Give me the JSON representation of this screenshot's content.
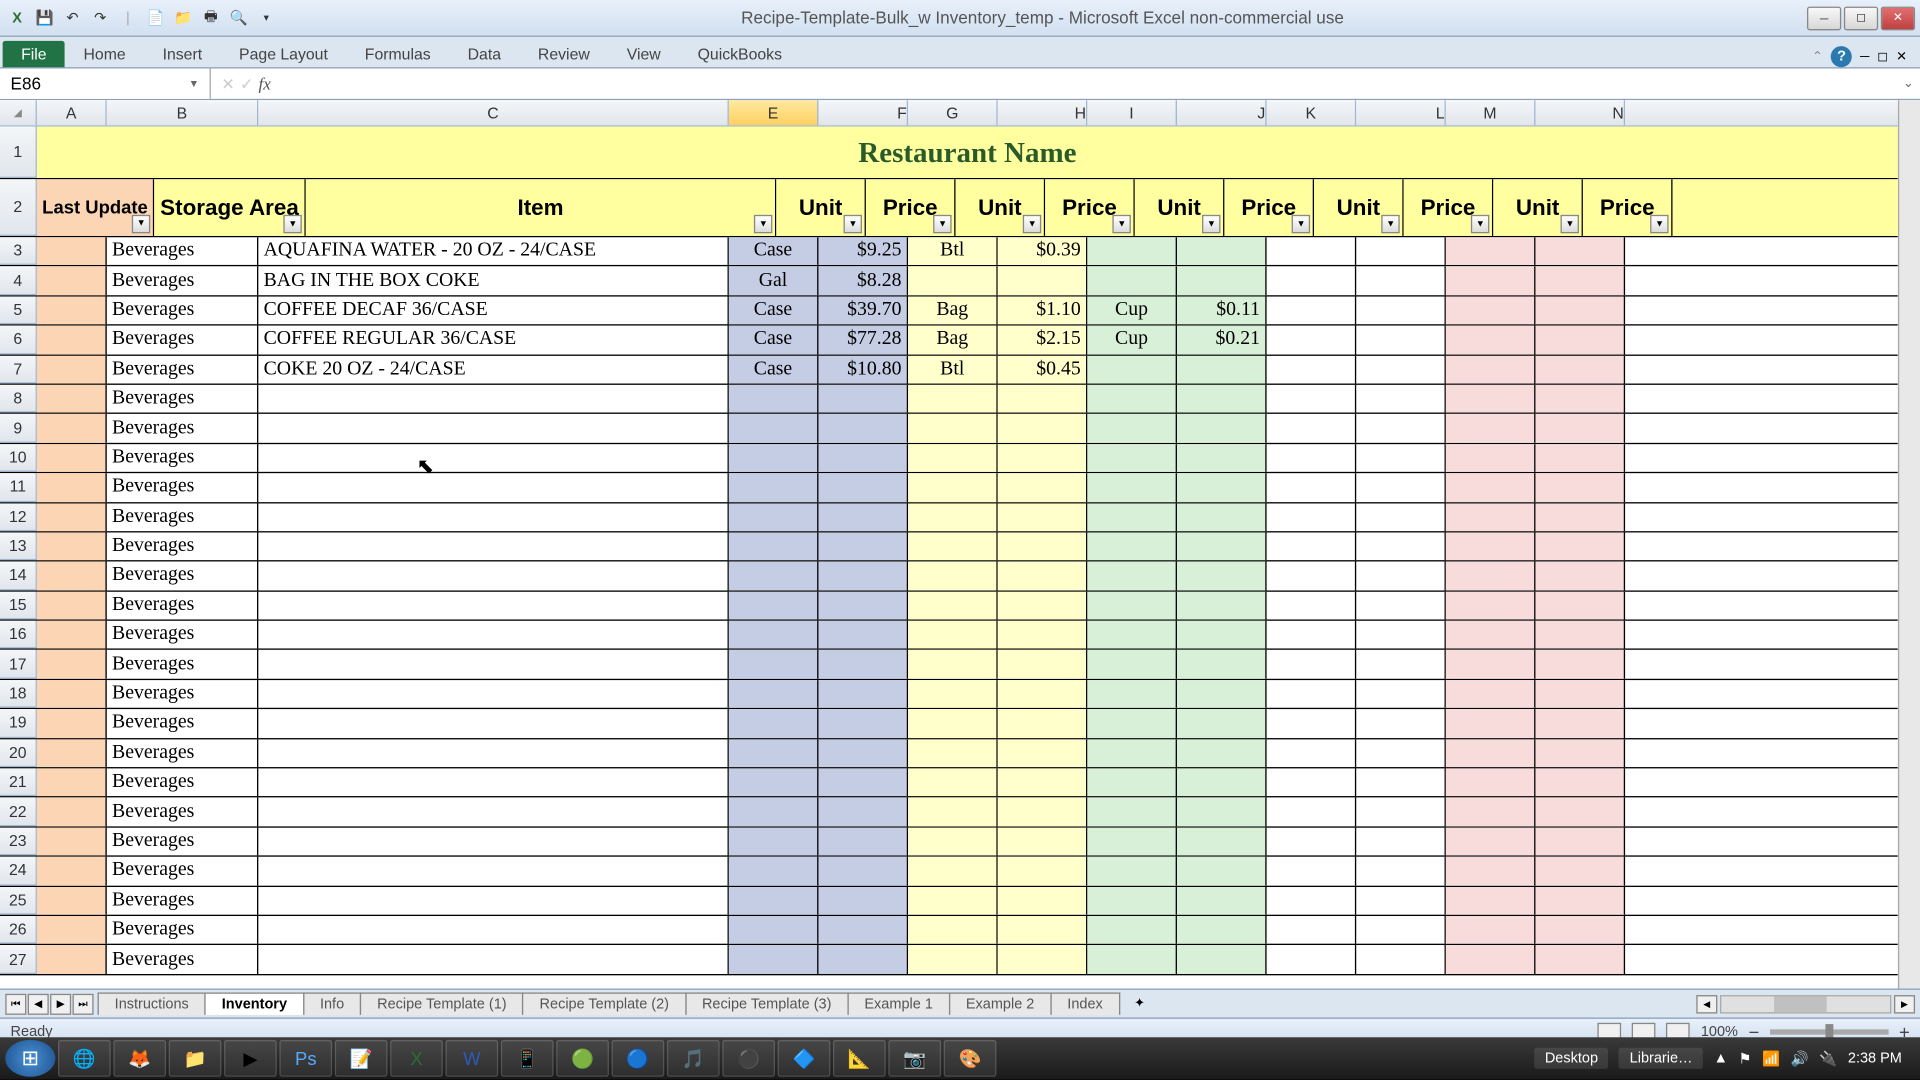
{
  "window": {
    "title": "Recipe-Template-Bulk_w Inventory_temp  -  Microsoft Excel non-commercial use"
  },
  "ribbon": {
    "file": "File",
    "tabs": [
      "Home",
      "Insert",
      "Page Layout",
      "Formulas",
      "Data",
      "Review",
      "View",
      "QuickBooks"
    ]
  },
  "formula_bar": {
    "name_box": "E86",
    "fx": "fx",
    "formula": ""
  },
  "columns": [
    "A",
    "B",
    "C",
    "E",
    "F",
    "G",
    "H",
    "I",
    "J",
    "K",
    "L",
    "M",
    "N"
  ],
  "selected_col": "E",
  "sheet": {
    "title": "Restaurant Name",
    "headers": {
      "a": "Last Update",
      "b": "Storage Area",
      "c": "Item",
      "unit": "Unit",
      "price": "Price"
    },
    "rows": [
      {
        "n": 3,
        "area": "Beverages",
        "item": "AQUAFINA WATER - 20 OZ - 24/CASE",
        "u1": "Case",
        "p1": "$9.25",
        "u2": "Btl",
        "p2": "$0.39",
        "u3": "",
        "p3": ""
      },
      {
        "n": 4,
        "area": "Beverages",
        "item": "BAG IN THE BOX COKE",
        "u1": "Gal",
        "p1": "$8.28",
        "u2": "",
        "p2": "",
        "u3": "",
        "p3": ""
      },
      {
        "n": 5,
        "area": "Beverages",
        "item": "COFFEE DECAF 36/CASE",
        "u1": "Case",
        "p1": "$39.70",
        "u2": "Bag",
        "p2": "$1.10",
        "u3": "Cup",
        "p3": "$0.11"
      },
      {
        "n": 6,
        "area": "Beverages",
        "item": "COFFEE REGULAR 36/CASE",
        "u1": "Case",
        "p1": "$77.28",
        "u2": "Bag",
        "p2": "$2.15",
        "u3": "Cup",
        "p3": "$0.21"
      },
      {
        "n": 7,
        "area": "Beverages",
        "item": "COKE 20 OZ - 24/CASE",
        "u1": "Case",
        "p1": "$10.80",
        "u2": "Btl",
        "p2": "$0.45",
        "u3": "",
        "p3": ""
      },
      {
        "n": 8,
        "area": "Beverages",
        "item": "",
        "u1": "",
        "p1": "",
        "u2": "",
        "p2": "",
        "u3": "",
        "p3": ""
      },
      {
        "n": 9,
        "area": "Beverages",
        "item": "",
        "u1": "",
        "p1": "",
        "u2": "",
        "p2": "",
        "u3": "",
        "p3": ""
      },
      {
        "n": 10,
        "area": "Beverages",
        "item": "",
        "u1": "",
        "p1": "",
        "u2": "",
        "p2": "",
        "u3": "",
        "p3": ""
      },
      {
        "n": 11,
        "area": "Beverages",
        "item": "",
        "u1": "",
        "p1": "",
        "u2": "",
        "p2": "",
        "u3": "",
        "p3": ""
      },
      {
        "n": 12,
        "area": "Beverages",
        "item": "",
        "u1": "",
        "p1": "",
        "u2": "",
        "p2": "",
        "u3": "",
        "p3": ""
      },
      {
        "n": 13,
        "area": "Beverages",
        "item": "",
        "u1": "",
        "p1": "",
        "u2": "",
        "p2": "",
        "u3": "",
        "p3": ""
      },
      {
        "n": 14,
        "area": "Beverages",
        "item": "",
        "u1": "",
        "p1": "",
        "u2": "",
        "p2": "",
        "u3": "",
        "p3": ""
      },
      {
        "n": 15,
        "area": "Beverages",
        "item": "",
        "u1": "",
        "p1": "",
        "u2": "",
        "p2": "",
        "u3": "",
        "p3": ""
      },
      {
        "n": 16,
        "area": "Beverages",
        "item": "",
        "u1": "",
        "p1": "",
        "u2": "",
        "p2": "",
        "u3": "",
        "p3": ""
      },
      {
        "n": 17,
        "area": "Beverages",
        "item": "",
        "u1": "",
        "p1": "",
        "u2": "",
        "p2": "",
        "u3": "",
        "p3": ""
      },
      {
        "n": 18,
        "area": "Beverages",
        "item": "",
        "u1": "",
        "p1": "",
        "u2": "",
        "p2": "",
        "u3": "",
        "p3": ""
      },
      {
        "n": 19,
        "area": "Beverages",
        "item": "",
        "u1": "",
        "p1": "",
        "u2": "",
        "p2": "",
        "u3": "",
        "p3": ""
      },
      {
        "n": 20,
        "area": "Beverages",
        "item": "",
        "u1": "",
        "p1": "",
        "u2": "",
        "p2": "",
        "u3": "",
        "p3": ""
      },
      {
        "n": 21,
        "area": "Beverages",
        "item": "",
        "u1": "",
        "p1": "",
        "u2": "",
        "p2": "",
        "u3": "",
        "p3": ""
      },
      {
        "n": 22,
        "area": "Beverages",
        "item": "",
        "u1": "",
        "p1": "",
        "u2": "",
        "p2": "",
        "u3": "",
        "p3": ""
      },
      {
        "n": 23,
        "area": "Beverages",
        "item": "",
        "u1": "",
        "p1": "",
        "u2": "",
        "p2": "",
        "u3": "",
        "p3": ""
      },
      {
        "n": 24,
        "area": "Beverages",
        "item": "",
        "u1": "",
        "p1": "",
        "u2": "",
        "p2": "",
        "u3": "",
        "p3": ""
      },
      {
        "n": 25,
        "area": "Beverages",
        "item": "",
        "u1": "",
        "p1": "",
        "u2": "",
        "p2": "",
        "u3": "",
        "p3": ""
      },
      {
        "n": 26,
        "area": "Beverages",
        "item": "",
        "u1": "",
        "p1": "",
        "u2": "",
        "p2": "",
        "u3": "",
        "p3": ""
      },
      {
        "n": 27,
        "area": "Beverages",
        "item": "",
        "u1": "",
        "p1": "",
        "u2": "",
        "p2": "",
        "u3": "",
        "p3": ""
      }
    ]
  },
  "sheet_tabs": {
    "items": [
      "Instructions",
      "Inventory",
      "Info",
      "Recipe Template (1)",
      "Recipe Template (2)",
      "Recipe Template (3)",
      "Example 1",
      "Example 2",
      "Index"
    ],
    "active": "Inventory"
  },
  "status": {
    "ready": "Ready",
    "zoom": "100%"
  },
  "taskbar": {
    "label": "Desktop",
    "label2": "Librarie…",
    "time": "2:38 PM"
  }
}
